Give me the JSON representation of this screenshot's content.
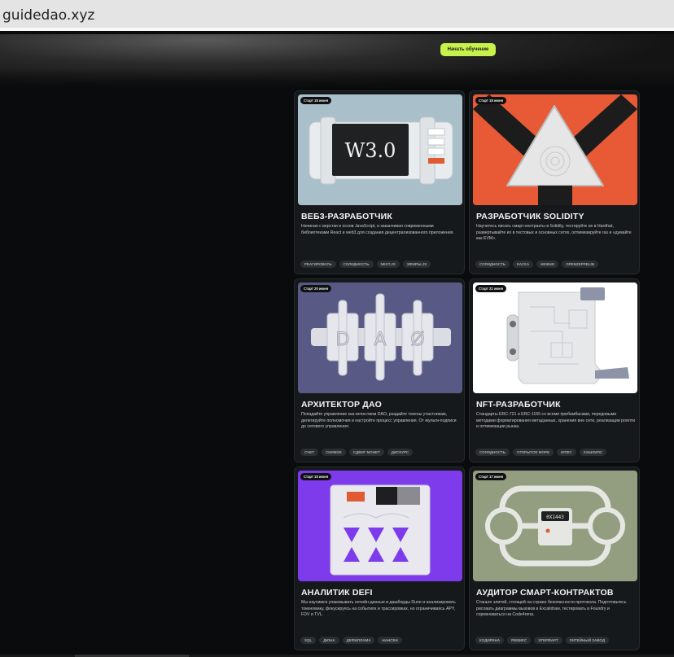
{
  "browser": {
    "url": "guidedao.xyz"
  },
  "hero": {
    "cta_label": "Начать обучение"
  },
  "cards": [
    {
      "badge": "Старт 18 июня",
      "title": "ВЕБ3-РАЗРАБОТЧИК",
      "description": "Начиная с верстки и основ JavaScript, и заканчивая современными библиотеками React и web3 для создания децентрализованного приложения.",
      "tags": [
        "РЕАГИРОВАТЬ",
        "СОЛИДНОСТЬ",
        "NEXT.JS",
        "ЭФИРЫ.JS"
      ],
      "image": {
        "bg": "#a9c0cb",
        "screen_text": "W3.0"
      }
    },
    {
      "badge": "Старт 18 июня",
      "title": "РАЗРАБОТЧИК SOLIDITY",
      "description": "Научитесь писать смарт-контракты в Solidity, тестируйте их в Hardhat, развертывайте их в тестовых и основных сетях, оптимизируйте газ и «думайте как EVM».",
      "tags": [
        "СОЛИДНОСТЬ",
        "КАСКА",
        "НЕЖНО",
        "OPENZEPPELIN"
      ],
      "image": {
        "bg": "#e85a35"
      }
    },
    {
      "badge": "Старт 20 июня",
      "title": "АРХИТЕКТОР ДАО",
      "description": "Попадайте управление каз-инчеством DAO, раздайте токены участникам, делегируйте полномочия и настройте процесс управления. От мульти-подписи до сетевого управления.",
      "tags": [
        "СЧЕТ",
        "СНИМОК",
        "СДВИГ МОНЕТ",
        "ДИСКУРС"
      ],
      "image": {
        "bg": "#585a85",
        "letters": [
          "D",
          "A",
          "Ø"
        ]
      }
    },
    {
      "badge": "Старт 21 июня",
      "title": "NFT-РАЗРАБОТЧИК",
      "description": "Стандарты ERC-721 и ERC-1155 со всеми прибамбасами, передовыми методами форматирования метаданных, хранения вне сети, реализации роялти и оптимизации рынка.",
      "tags": [
        "СОЛИДНОСТЬ",
        "ОТКРЫТОЕ МОРЕ",
        "ИПФС",
        "ХЭШЛИПС"
      ],
      "image": {
        "bg": "#ffffff"
      }
    },
    {
      "badge": "Старт 15 июня",
      "title": "АНАЛИТИК DEFI",
      "description": "Мы научимся упаковывать ончейн-данные в дашборды Dune и анализировать токеномику, фокусируясь на событиях и трассировках, но ограничиваясь APY, FDV и TVL.",
      "tags": [
        "SQL",
        "ДЮНА",
        "ДЕФИЛЛАМА",
        "НАНСЕН"
      ],
      "image": {
        "bg": "#7d3bec"
      }
    },
    {
      "badge": "Старт 17 июня",
      "title": "АУДИТОР СМАРТ-КОНТРАКТОВ",
      "description": "Станьте элитой, стоящей на страже безопасности протокола. Подготовьтесь рисовать диаграммы вызовов в Excalidraw, тестировать в Foundry и соревноваться на Code4rena.",
      "tags": [
        "КОДИРЕНА",
        "РЕМИКС",
        "ЭТЕРФАРТ",
        "ЛИТЕЙНЫЙ ЗАВОД"
      ],
      "image": {
        "bg": "#939e80",
        "screen_text": "0X1443"
      }
    }
  ]
}
